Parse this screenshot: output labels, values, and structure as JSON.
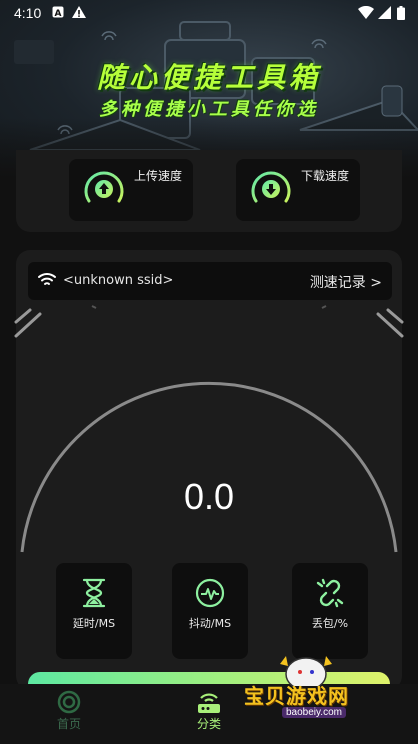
{
  "status_bar": {
    "time": "4:10"
  },
  "banner": {
    "title": "随心便捷工具箱",
    "subtitle": "多种便捷小工具任你选"
  },
  "speed_card": {
    "upload_label": "上传速度",
    "download_label": "下载速度"
  },
  "network": {
    "ssid": "<unknown ssid>",
    "record_link": "测速记录 >"
  },
  "gauge": {
    "value": "0.0",
    "level": 0
  },
  "metrics": [
    {
      "label": "延时/MS",
      "icon": "hourglass-icon"
    },
    {
      "label": "抖动/MS",
      "icon": "pulse-icon"
    },
    {
      "label": "丢包/%",
      "icon": "broken-link-icon"
    }
  ],
  "bottom_nav": [
    {
      "label": "首页",
      "icon": "home-ring-icon",
      "active": false
    },
    {
      "label": "分类",
      "icon": "router-icon",
      "active": true
    }
  ],
  "watermark": {
    "text": "宝贝游戏网",
    "url": "baobeiy.com"
  },
  "colors": {
    "accent_green": "#a3f07e",
    "teal": "#5de8a2",
    "panel": "#1c1c1c",
    "background": "#111111"
  }
}
